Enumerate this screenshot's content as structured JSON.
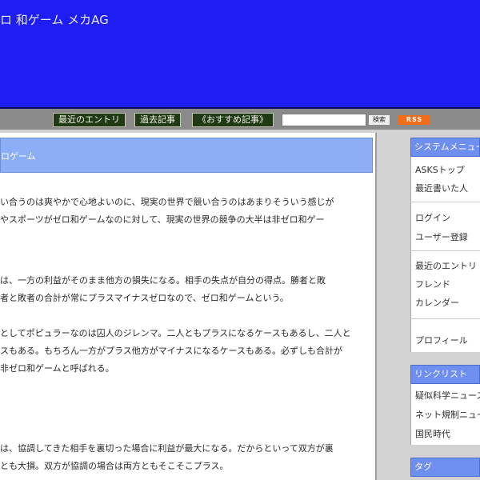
{
  "header": {
    "title": "ロ 和ゲーム  メカAG"
  },
  "navbar": {
    "items": [
      "最近のエントリ",
      "過去記事",
      "《おすすめ記事》"
    ],
    "search_placeholder": "",
    "search_button": "検索",
    "rss_label": "RSS"
  },
  "entry": {
    "title": "ロゲーム",
    "paragraphs": [
      "い合うのは爽やかで心地よいのに、現実の世界で競い合うのはあまりそういう感じが\nやスポーツがゼロ和ゲームなのに対して、現実の世界の競争の大半は非ゼロ和ゲー",
      "は、一方の利益がそのまま他方の損失になる。相手の失点が自分の得点。勝者と敗\n者と敗者の合計が常にプラスマイナスゼロなので、ゼロ和ゲームという。",
      "としてポピュラーなのは囚人のジレンマ。二人ともプラスになるケースもあるし、二人と\nスもある。もちろん一方がプラス他方がマイナスになるケースもある。必ずしも合計が\n非ゼロ和ゲームと呼ばれる。",
      "は、協調してきた相手を裏切った場合に利益が最大になる。だからといって双方が裏\nとも大損。双方が協調の場合は両方ともそこそこプラス。"
    ]
  },
  "sidebar": {
    "system_menu": {
      "title": "システムメニュー",
      "groups": [
        [
          "ASKSトップ",
          "最近書いた人"
        ],
        [
          "ログイン",
          "ユーザー登録"
        ],
        [
          "最近のエントリ",
          "フレンド",
          "カレンダー"
        ],
        [
          "プロフィール"
        ]
      ]
    },
    "link_list": {
      "title": "リンクリスト",
      "items": [
        "疑似科学ニュース",
        "ネット規制ニュース",
        "国民時代"
      ]
    },
    "tags": {
      "title": "タグ"
    }
  }
}
